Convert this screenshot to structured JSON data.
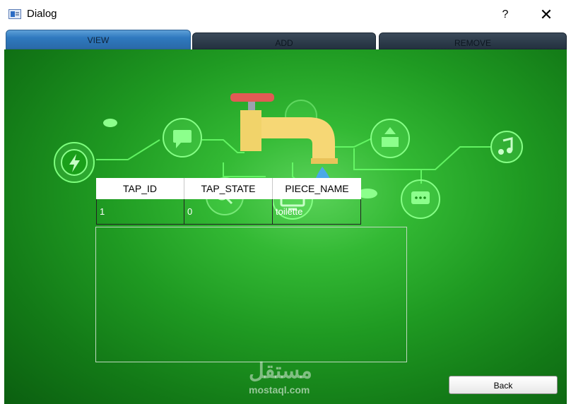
{
  "window": {
    "title": "Dialog",
    "help_label": "?",
    "close_label": "✕"
  },
  "tabs": [
    {
      "label": "VIEW",
      "active": true
    },
    {
      "label": "ADD",
      "active": false
    },
    {
      "label": "REMOVE",
      "active": false
    }
  ],
  "table": {
    "columns": [
      "TAP_ID",
      "TAP_STATE",
      "PIECE_NAME"
    ],
    "rows": [
      [
        "1",
        "0",
        "toilette"
      ]
    ]
  },
  "back_button": {
    "label": "Back"
  },
  "watermark": {
    "arabic": "مستقل",
    "latin": "mostaql.com"
  },
  "colors": {
    "tab_active": "#2f79bf",
    "tab_inactive": "#2b3a4a",
    "background_green": "#1f9a22"
  }
}
